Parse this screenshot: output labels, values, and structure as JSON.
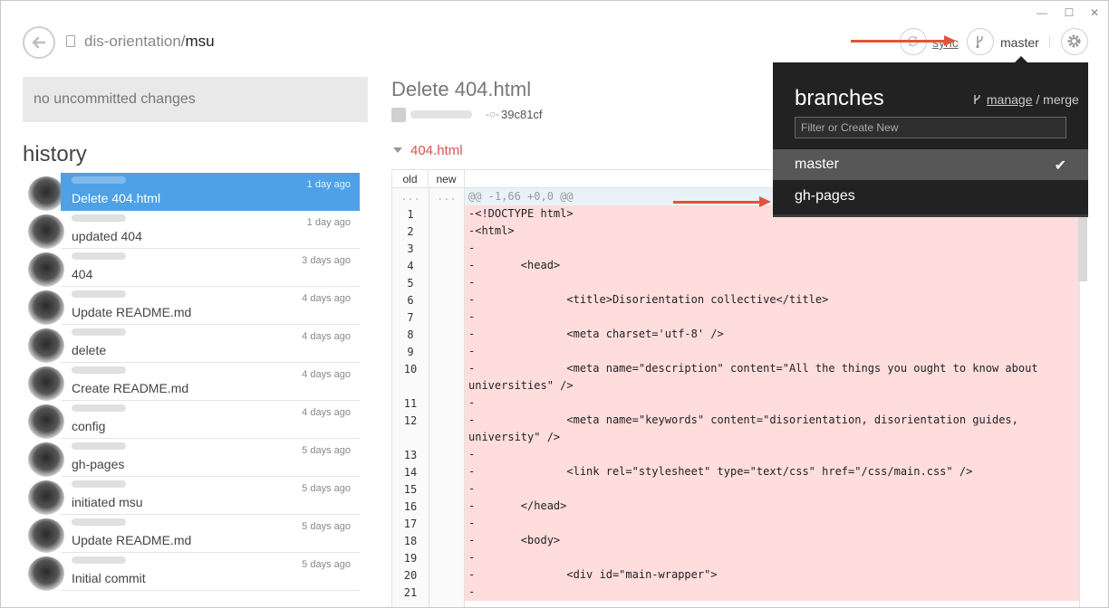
{
  "window": {
    "minimize": "—",
    "maximize": "☐",
    "close": "✕"
  },
  "header": {
    "repo_owner": "dis-orientation",
    "repo_separator": "/",
    "repo_name": "msu",
    "sync_label": "sync",
    "branch_label": "master"
  },
  "changes": {
    "status": "no uncommitted changes"
  },
  "history": {
    "title": "history",
    "items": [
      {
        "time": "1 day ago",
        "message": "Delete 404.html",
        "selected": true
      },
      {
        "time": "1 day ago",
        "message": "updated 404"
      },
      {
        "time": "3 days ago",
        "message": "404"
      },
      {
        "time": "4 days ago",
        "message": "Update README.md"
      },
      {
        "time": "4 days ago",
        "message": "delete"
      },
      {
        "time": "4 days ago",
        "message": "Create README.md"
      },
      {
        "time": "4 days ago",
        "message": "config"
      },
      {
        "time": "5 days ago",
        "message": "gh-pages"
      },
      {
        "time": "5 days ago",
        "message": "initiated msu"
      },
      {
        "time": "5 days ago",
        "message": "Update README.md"
      },
      {
        "time": "5 days ago",
        "message": "Initial commit"
      }
    ]
  },
  "commit": {
    "title": "Delete 404.html",
    "sha": "39c81cf",
    "file": "404.html"
  },
  "diff": {
    "col_old": "old",
    "col_new": "new",
    "hunk_old": "...",
    "hunk_new": "...",
    "hunk_header": "@@ -1,66 +0,0 @@",
    "lines": [
      {
        "n": "1",
        "code": "-<!DOCTYPE html>"
      },
      {
        "n": "2",
        "code": "-<html>"
      },
      {
        "n": "3",
        "code": "-"
      },
      {
        "n": "4",
        "code": "-       <head>"
      },
      {
        "n": "5",
        "code": "-"
      },
      {
        "n": "6",
        "code": "-              <title>Disorientation collective</title>"
      },
      {
        "n": "7",
        "code": "-"
      },
      {
        "n": "8",
        "code": "-              <meta charset='utf-8' />"
      },
      {
        "n": "9",
        "code": "-"
      },
      {
        "n": "10",
        "code": "-              <meta name=\"description\" content=\"All the things you ought to know about universities\" />",
        "tall": true
      },
      {
        "n": "11",
        "code": "-"
      },
      {
        "n": "12",
        "code": "-              <meta name=\"keywords\" content=\"disorientation, disorientation guides, university\" />",
        "tall": true
      },
      {
        "n": "13",
        "code": "-"
      },
      {
        "n": "14",
        "code": "-              <link rel=\"stylesheet\" type=\"text/css\" href=\"/css/main.css\" />"
      },
      {
        "n": "15",
        "code": "-"
      },
      {
        "n": "16",
        "code": "-       </head>"
      },
      {
        "n": "17",
        "code": "-"
      },
      {
        "n": "18",
        "code": "-       <body>"
      },
      {
        "n": "19",
        "code": "-"
      },
      {
        "n": "20",
        "code": "-              <div id=\"main-wrapper\">"
      },
      {
        "n": "21",
        "code": "-"
      }
    ]
  },
  "branches_popup": {
    "title": "branches",
    "manage": "manage",
    "merge": "merge",
    "filter_placeholder": "Filter or Create New",
    "items": [
      {
        "name": "master",
        "active": true
      },
      {
        "name": "gh-pages"
      }
    ],
    "check_glyph": "✔"
  },
  "colors": {
    "selected_row": "#4ea1e6",
    "deleted_line": "#ffdddd",
    "hunk_bg": "#eaf2f9",
    "popup_bg": "#222222",
    "annotation_arrow": "#e2533d"
  },
  "icons": [
    "back-arrow-icon",
    "repo-icon",
    "sync-icon",
    "branch-icon",
    "gear-icon",
    "commit-icon",
    "checkmark-icon"
  ]
}
